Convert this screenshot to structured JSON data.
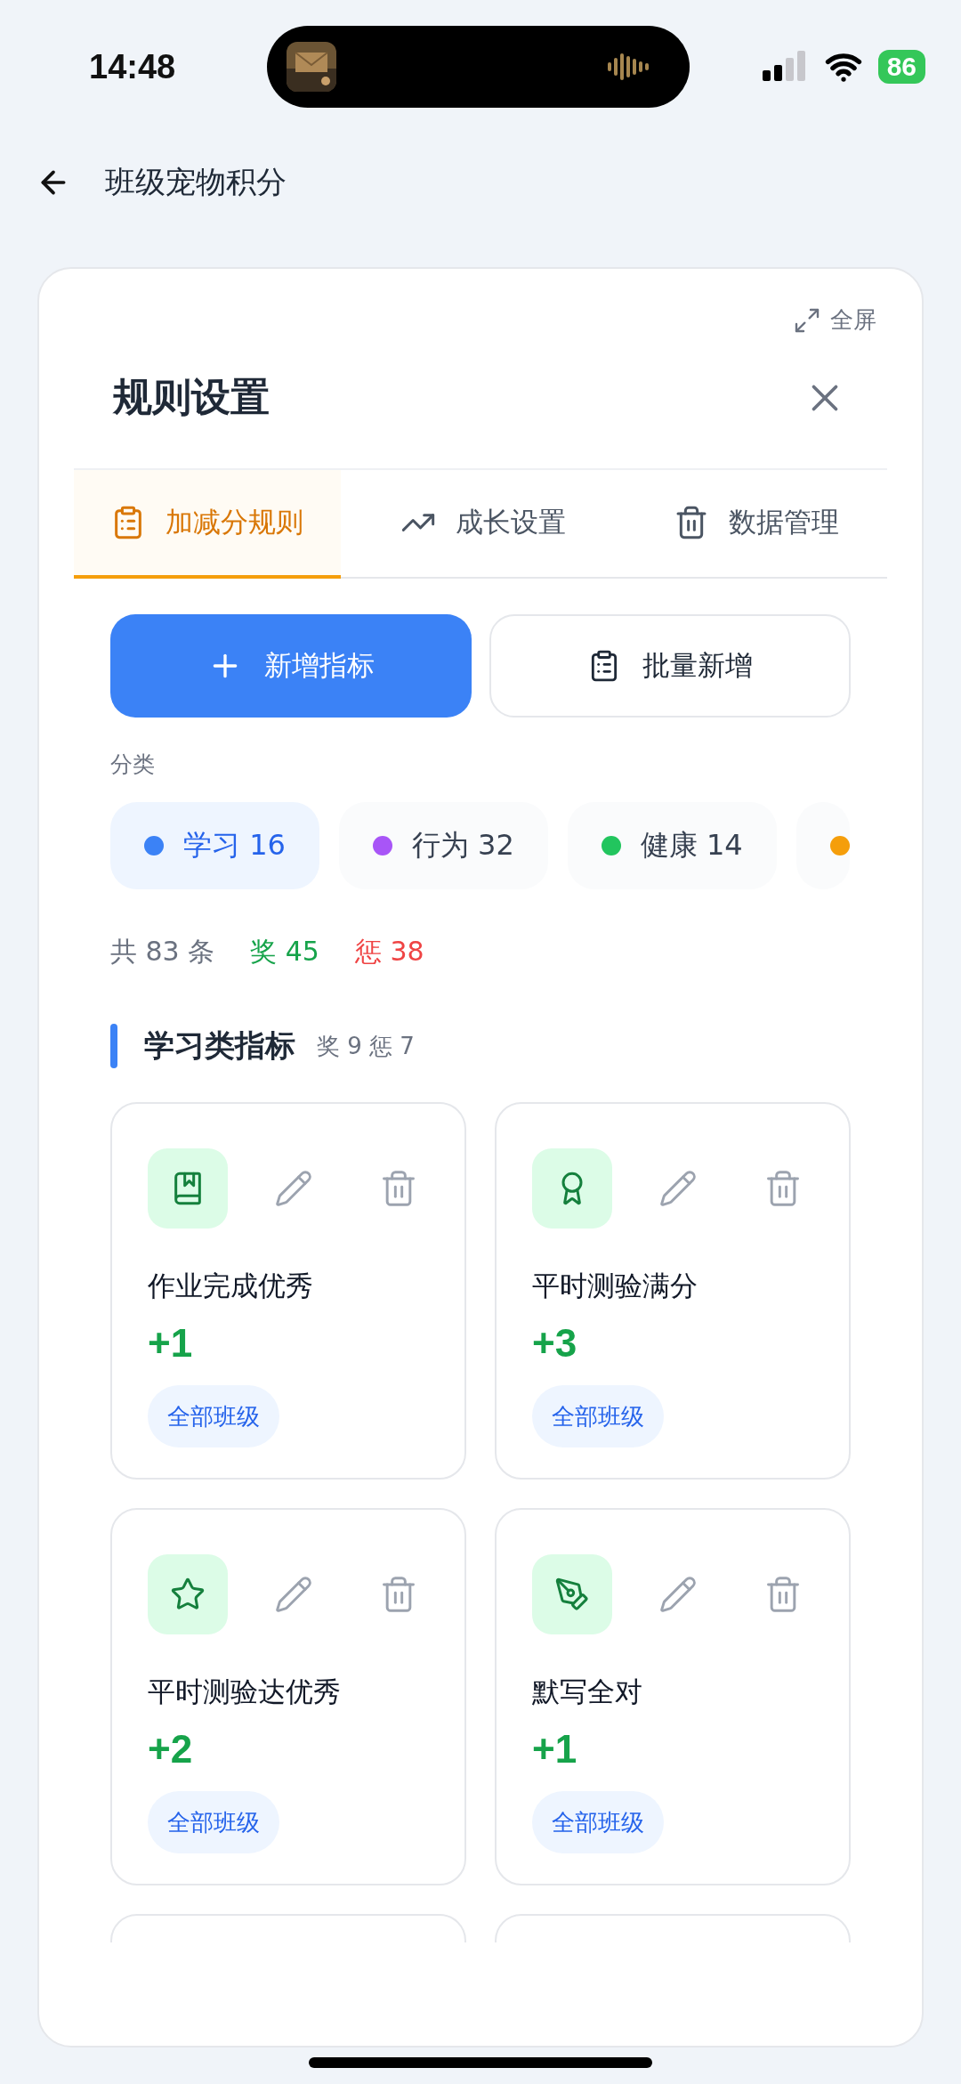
{
  "status_bar": {
    "time": "14:48",
    "battery": "86"
  },
  "header": {
    "title": "班级宠物积分"
  },
  "dialog": {
    "fullscreen_label": "全屏",
    "title": "规则设置",
    "tabs": [
      {
        "label": "加减分规则",
        "selected": true
      },
      {
        "label": "成长设置",
        "selected": false
      },
      {
        "label": "数据管理",
        "selected": false
      }
    ],
    "buttons": [
      {
        "label": "新增指标",
        "kind": "primary"
      },
      {
        "label": "批量新增",
        "kind": "secondary"
      }
    ],
    "category_label": "分类",
    "categories": [
      {
        "label": "学习 16",
        "color": "#3b82f6",
        "selected": true
      },
      {
        "label": "行为 32",
        "color": "#a855f7",
        "selected": false
      },
      {
        "label": "健康 14",
        "color": "#22c55e",
        "selected": false
      },
      {
        "color": "#f59e0b",
        "selected": false
      }
    ],
    "summary": {
      "total": "共 83 条",
      "reward": "奖 45",
      "penalty": "惩 38"
    },
    "section": {
      "title": "学习类指标",
      "counts": "奖 9 惩 7"
    },
    "rules": [
      {
        "kind": "full",
        "name": "作业完成优秀",
        "points": "+1",
        "scope": "全部班级"
      },
      {
        "kind": "full",
        "name": "平时测验满分",
        "points": "+3",
        "scope": "全部班级"
      },
      {
        "kind": "full",
        "name": "平时测验达优秀",
        "points": "+2",
        "scope": "全部班级"
      },
      {
        "kind": "full",
        "name": "默写全对",
        "points": "+1",
        "scope": "全部班级"
      },
      {
        "kind": "clipped"
      },
      {
        "kind": "clipped"
      }
    ]
  }
}
